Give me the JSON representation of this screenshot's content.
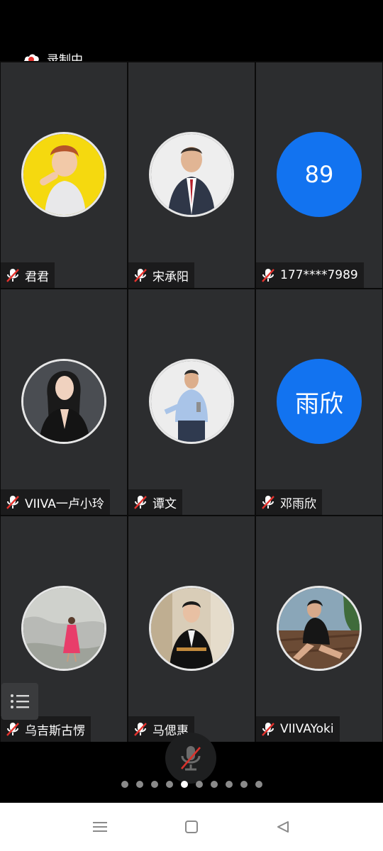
{
  "recording": {
    "label": "录制中"
  },
  "participants": [
    {
      "name": "君君",
      "avatar_type": "photo",
      "avatar_desc": "woman-yellow-bg"
    },
    {
      "name": "宋承阳",
      "avatar_type": "photo",
      "avatar_desc": "man-suit"
    },
    {
      "name": "177****7989",
      "avatar_type": "text",
      "avatar_text": "89"
    },
    {
      "name": "VIIVA一卢小玲",
      "avatar_type": "photo",
      "avatar_desc": "woman-black-dress"
    },
    {
      "name": "谭文",
      "avatar_type": "photo",
      "avatar_desc": "man-light-shirt"
    },
    {
      "name": "邓雨欣",
      "avatar_type": "text",
      "avatar_text": "雨欣"
    },
    {
      "name": "乌吉斯古愣",
      "avatar_type": "photo",
      "avatar_desc": "woman-pink-dress-rock"
    },
    {
      "name": "马偲惠",
      "avatar_type": "photo",
      "avatar_desc": "woman-black-jacket"
    },
    {
      "name": "VIIVAYoki",
      "avatar_type": "photo",
      "avatar_desc": "woman-sitting-outdoor"
    }
  ],
  "pager": {
    "count": 10,
    "active_index": 4
  },
  "colors": {
    "tile_bg": "#2c2d2f",
    "text_avatar_bg": "#1273f0",
    "mic_muted": "#e5322d"
  },
  "icons": {
    "recording": "cloud-record-icon",
    "mic": "mic-muted-icon",
    "menu": "list-menu-icon",
    "nav": [
      "menu-icon",
      "home-square-icon",
      "back-triangle-icon"
    ]
  }
}
